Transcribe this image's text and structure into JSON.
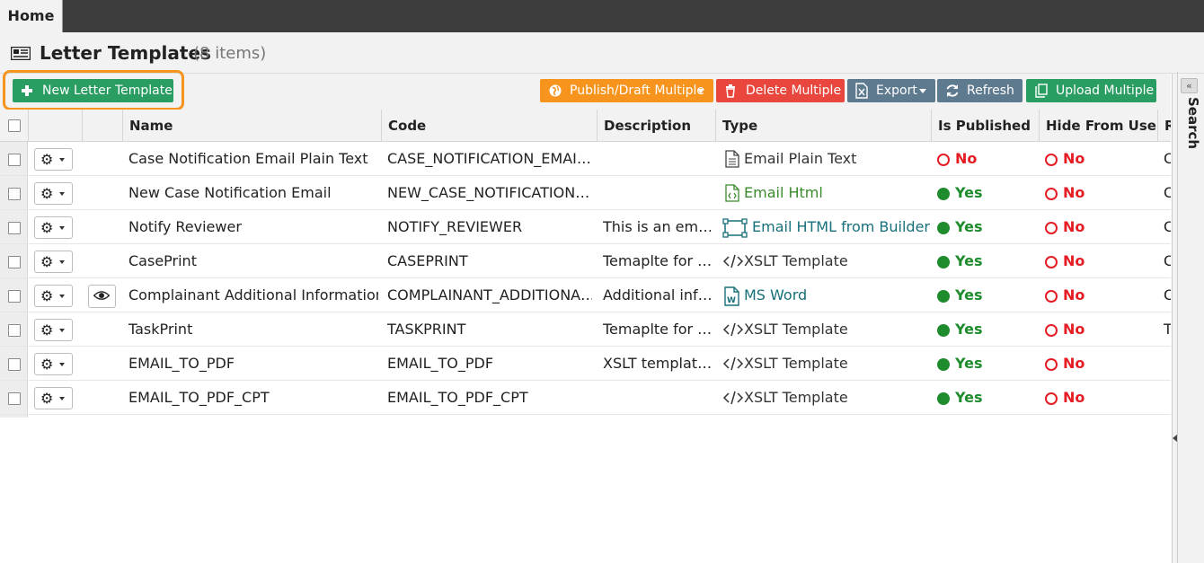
{
  "tabs": [
    {
      "label": "Home"
    }
  ],
  "header": {
    "title": "Letter Templates",
    "count": "(8 items)"
  },
  "toolbar": {
    "new_label": "New Letter Template",
    "publish_label": "Publish/Draft Multiple",
    "delete_label": "Delete Multiple",
    "export_label": "Export",
    "refresh_label": "Refresh",
    "upload_label": "Upload Multiple"
  },
  "right_panel": {
    "label": "Search",
    "collapse": "«"
  },
  "columns": {
    "name": "Name",
    "code": "Code",
    "description": "Description",
    "type": "Type",
    "is_published": "Is Published",
    "hide_from_user": "Hide From User",
    "r": "R"
  },
  "rows": [
    {
      "name": "Case Notification Email Plain Text",
      "code": "CASE_NOTIFICATION_EMAI…",
      "description": "",
      "type": "Email Plain Text",
      "type_icon": "document-icon",
      "published": "No",
      "hidden": "No",
      "extra": "C",
      "has_preview": false
    },
    {
      "name": "New Case Notification Email",
      "code": "NEW_CASE_NOTIFICATION…",
      "description": "",
      "type": "Email Html",
      "type_icon": "html-file-icon",
      "published": "Yes",
      "hidden": "No",
      "extra": "C",
      "has_preview": false
    },
    {
      "name": "Notify Reviewer",
      "code": "NOTIFY_REVIEWER",
      "description": "This is an em…",
      "type": "Email HTML from Builder",
      "type_icon": "builder-icon",
      "published": "Yes",
      "hidden": "No",
      "extra": "C",
      "has_preview": false
    },
    {
      "name": "CasePrint",
      "code": "CASEPRINT",
      "description": "Temaplte for …",
      "type": "XSLT Template",
      "type_icon": "code-icon",
      "published": "Yes",
      "hidden": "No",
      "extra": "C",
      "has_preview": false
    },
    {
      "name": "Complainant Additional Information",
      "code": "COMPLAINANT_ADDITIONA…",
      "description": "Additional inf…",
      "type": "MS Word",
      "type_icon": "word-icon",
      "published": "Yes",
      "hidden": "No",
      "extra": "C",
      "has_preview": true
    },
    {
      "name": "TaskPrint",
      "code": "TASKPRINT",
      "description": "Temaplte for …",
      "type": "XSLT Template",
      "type_icon": "code-icon",
      "published": "Yes",
      "hidden": "No",
      "extra": "T",
      "has_preview": false
    },
    {
      "name": "EMAIL_TO_PDF",
      "code": "EMAIL_TO_PDF",
      "description": "XSLT templat…",
      "type": "XSLT Template",
      "type_icon": "code-icon",
      "published": "Yes",
      "hidden": "No",
      "extra": "",
      "has_preview": false
    },
    {
      "name": "EMAIL_TO_PDF_CPT",
      "code": "EMAIL_TO_PDF_CPT",
      "description": "",
      "type": "XSLT Template",
      "type_icon": "code-icon",
      "published": "Yes",
      "hidden": "No",
      "extra": "",
      "has_preview": false
    }
  ],
  "colors": {
    "accent_green": "#2a9d63",
    "orange": "#f7941d",
    "red": "#e9463e",
    "slate": "#5e7a8f",
    "yes": "#1e8c2d",
    "no": "#e51c23"
  }
}
